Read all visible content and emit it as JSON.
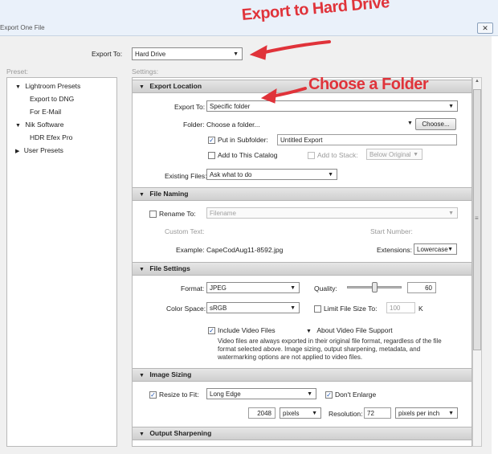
{
  "window": {
    "title": "Export One File",
    "close_glyph": "✕"
  },
  "annotations": {
    "export_to_hard_drive": "Export to Hard Drive",
    "choose_a_folder": "Choose a Folder",
    "color": "#e0333a"
  },
  "top": {
    "export_to_label": "Export To:",
    "export_to_value": "Hard Drive"
  },
  "columns": {
    "preset": "Preset:",
    "settings": "Settings:"
  },
  "presets": {
    "lightroom": {
      "label": "Lightroom Presets",
      "children": [
        "Export to DNG",
        "For E-Mail"
      ]
    },
    "nik": {
      "label": "Nik Software",
      "children": [
        "HDR Efex Pro"
      ]
    },
    "user": {
      "label": "User Presets"
    }
  },
  "export_location": {
    "header": "Export Location",
    "export_to_label": "Export To:",
    "export_to_value": "Specific folder",
    "folder_label": "Folder:",
    "folder_value": "Choose a folder...",
    "choose_button": "Choose...",
    "subfolder_label": "Put in Subfolder:",
    "subfolder_checked": true,
    "subfolder_value": "Untitled Export",
    "catalog_label": "Add to This Catalog",
    "stack_label": "Add to Stack:",
    "stack_value": "Below Original",
    "existing_label": "Existing Files:",
    "existing_value": "Ask what to do"
  },
  "file_naming": {
    "header": "File Naming",
    "rename_label": "Rename To:",
    "rename_value": "Filename",
    "custom_text_label": "Custom Text:",
    "start_number_label": "Start Number:",
    "example_label": "Example:",
    "example_value": "CapeCodAug11-8592.jpg",
    "extensions_label": "Extensions:",
    "extensions_value": "Lowercase"
  },
  "file_settings": {
    "header": "File Settings",
    "format_label": "Format:",
    "format_value": "JPEG",
    "quality_label": "Quality:",
    "quality_value": "60",
    "quality_fraction": 0.6,
    "color_space_label": "Color Space:",
    "color_space_value": "sRGB",
    "limit_label": "Limit File Size To:",
    "limit_value": "100",
    "limit_unit": "K",
    "video_label": "Include Video Files",
    "video_support": "About Video File Support",
    "video_note": "Video files are always exported in their original file format, regardless of the file format selected above. Image sizing, output sharpening, metadata, and watermarking options are not applied to video files."
  },
  "image_sizing": {
    "header": "Image Sizing",
    "resize_label": "Resize to Fit:",
    "resize_value": "Long Edge",
    "dont_enlarge_label": "Don't Enlarge",
    "size_value": "2048",
    "size_unit": "pixels",
    "resolution_label": "Resolution:",
    "resolution_value": "72",
    "resolution_unit": "pixels per inch"
  },
  "output_sharpening": {
    "header": "Output Sharpening"
  },
  "glyphs": {
    "check": "✓",
    "arrow_down": "▼",
    "triangle_down": "▼",
    "triangle_right": "▶",
    "grip": "≡"
  }
}
